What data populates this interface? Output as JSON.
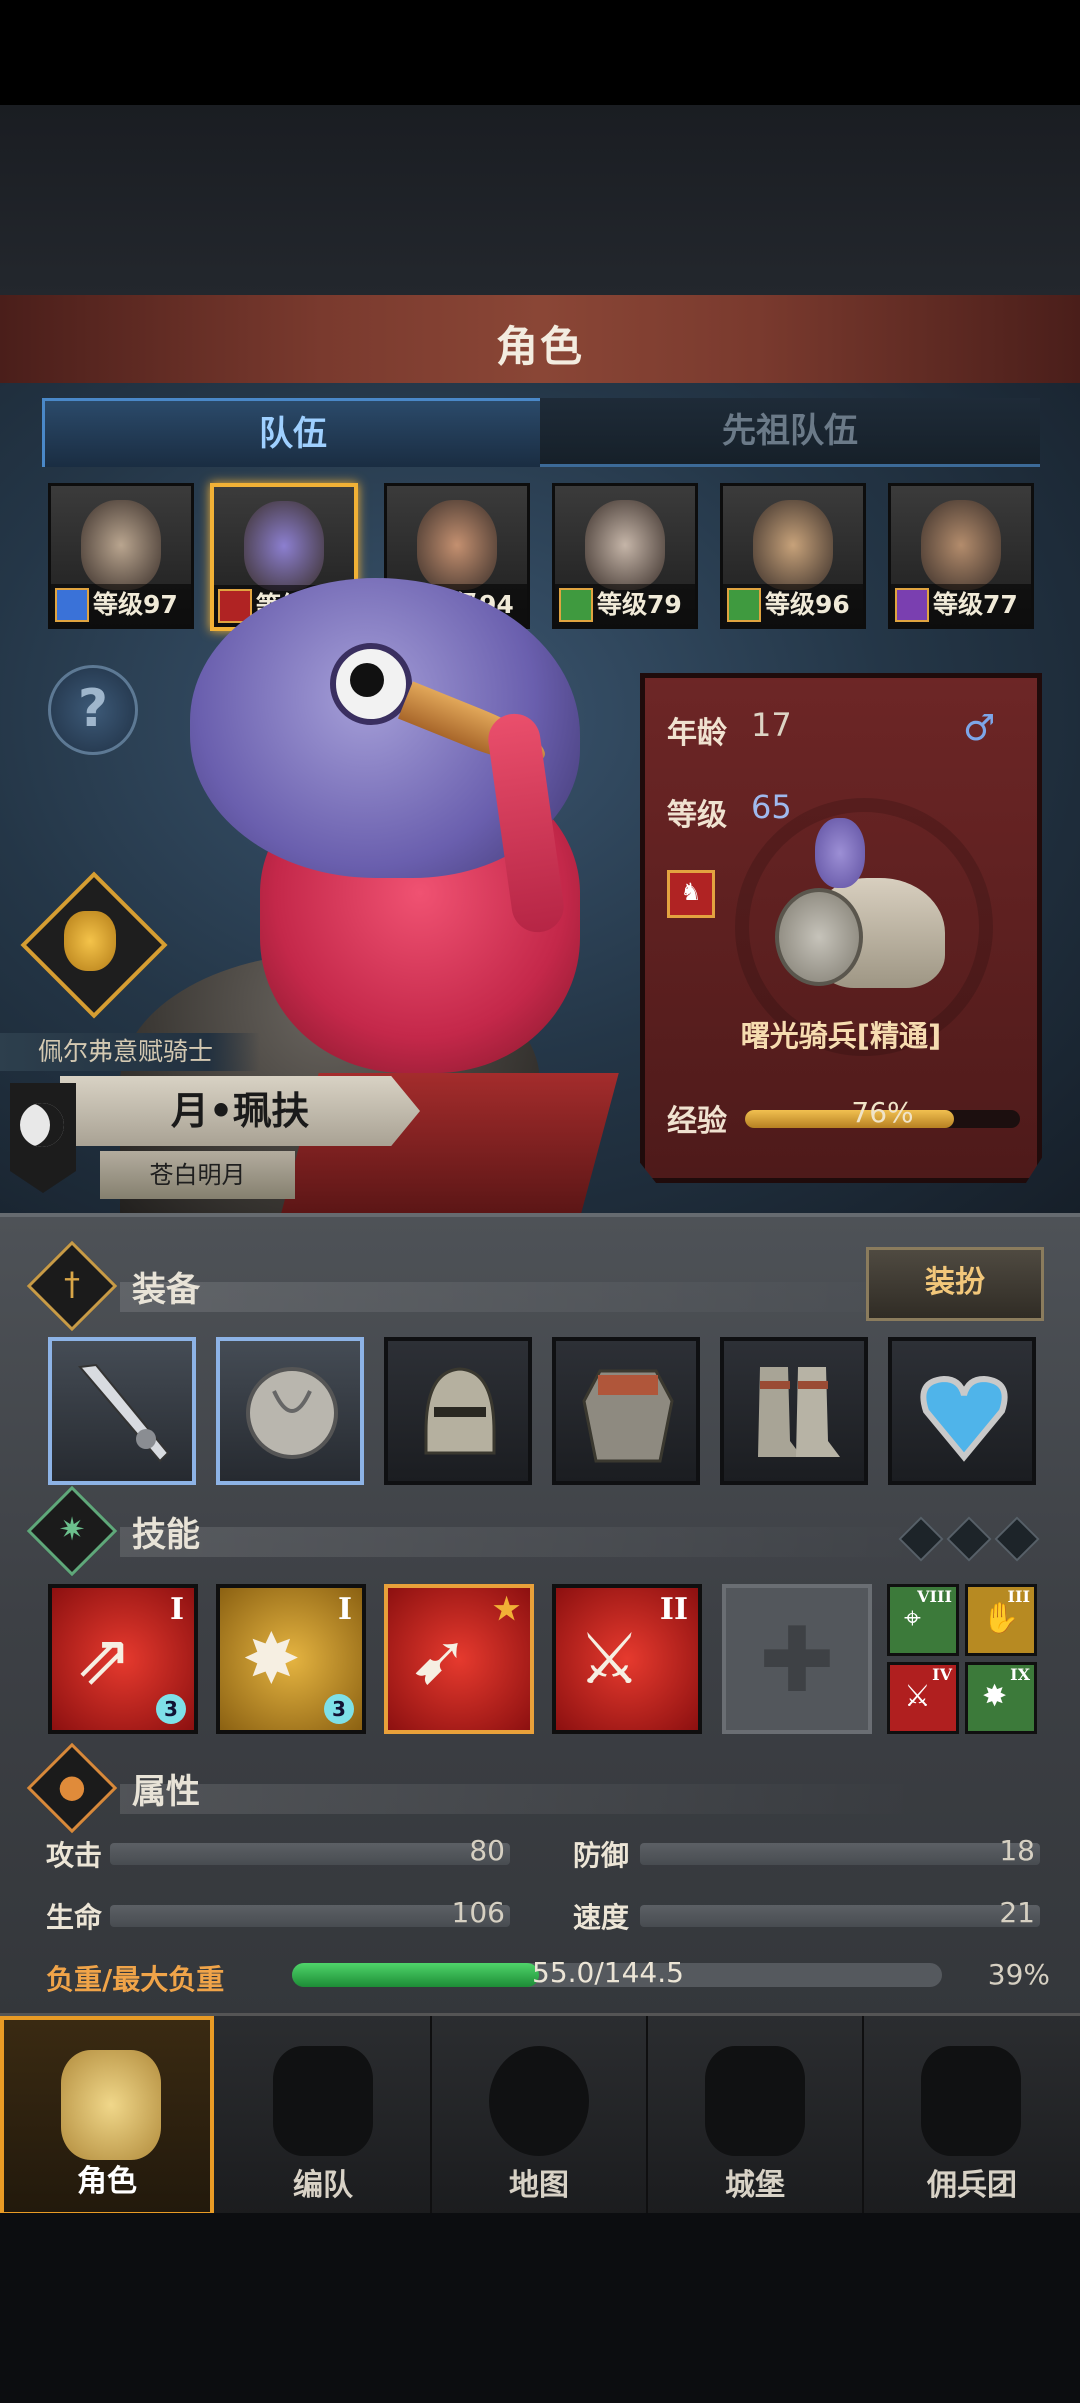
{
  "header": {
    "title": "角色"
  },
  "tabs": {
    "team": "队伍",
    "ancestor": "先祖队伍"
  },
  "roster": [
    {
      "level": "等级97",
      "class_color": "#3a72d8",
      "face_color": "#b9a58f"
    },
    {
      "level": "等级65",
      "class_color": "#b02323",
      "face_color": "#8c7fd0",
      "selected": true
    },
    {
      "level": "等级94",
      "class_color": "#d89a2a",
      "face_color": "#c49070"
    },
    {
      "level": "等级79",
      "class_color": "#3f9a3f",
      "face_color": "#c5b5a8"
    },
    {
      "level": "等级96",
      "class_color": "#3f9a3f",
      "face_color": "#c7a27a"
    },
    {
      "level": "等级77",
      "class_color": "#7a3fb0",
      "face_color": "#b38c6c"
    }
  ],
  "character": {
    "faction": "佩尔弗意赋骑士",
    "name": "月•珮扶",
    "title": "苍白明月"
  },
  "info": {
    "age_label": "年龄",
    "age": "17",
    "gender_icon": "male-icon",
    "gender_symbol": "♂",
    "level_label": "等级",
    "level": "65",
    "unit_name": "曙光骑兵[精通]",
    "exp_label": "经验",
    "exp_text": "76%",
    "exp_fraction": 0.76
  },
  "equipment": {
    "title": "装备",
    "outfit_button": "装扮",
    "slots": [
      "lance",
      "round-shield",
      "helmet",
      "chainmail-armor",
      "boots",
      "heart-amulet"
    ]
  },
  "skills": {
    "title": "技能",
    "items": [
      {
        "roman": "I",
        "badge": "3",
        "color": "red"
      },
      {
        "roman": "I",
        "badge": "3",
        "color": "gold"
      },
      {
        "roman": "",
        "badge": "",
        "color": "red"
      },
      {
        "roman": "II",
        "badge": "",
        "color": "red"
      }
    ],
    "mini": [
      {
        "roman": "VIII",
        "color": "#3c7a3a",
        "glyph": "target"
      },
      {
        "roman": "III",
        "color": "#b78a22",
        "glyph": "hand"
      },
      {
        "roman": "IV",
        "color": "#b01f1f",
        "glyph": "sword"
      },
      {
        "roman": "IX",
        "color": "#3c7a3a",
        "glyph": "burst"
      }
    ]
  },
  "attributes": {
    "title": "属性",
    "attack_label": "攻击",
    "attack": "80",
    "defense_label": "防御",
    "defense": "18",
    "hp_label": "生命",
    "hp": "106",
    "speed_label": "速度",
    "speed": "21",
    "load_label": "负重/最大负重",
    "load_text": "55.0/144.5",
    "load_percent": "39%",
    "load_fraction": 0.38
  },
  "nav": [
    {
      "label": "角色",
      "icon": "knight-icon",
      "active": true
    },
    {
      "label": "编队",
      "icon": "helmet-icon"
    },
    {
      "label": "地图",
      "icon": "compass-map-icon"
    },
    {
      "label": "城堡",
      "icon": "castle-icon"
    },
    {
      "label": "佣兵团",
      "icon": "mercenary-flag-icon"
    }
  ],
  "colors": {
    "accent": "#f1b136",
    "header": "#7a3a2e",
    "exp": "#f1c050",
    "load": "#3cb456"
  }
}
